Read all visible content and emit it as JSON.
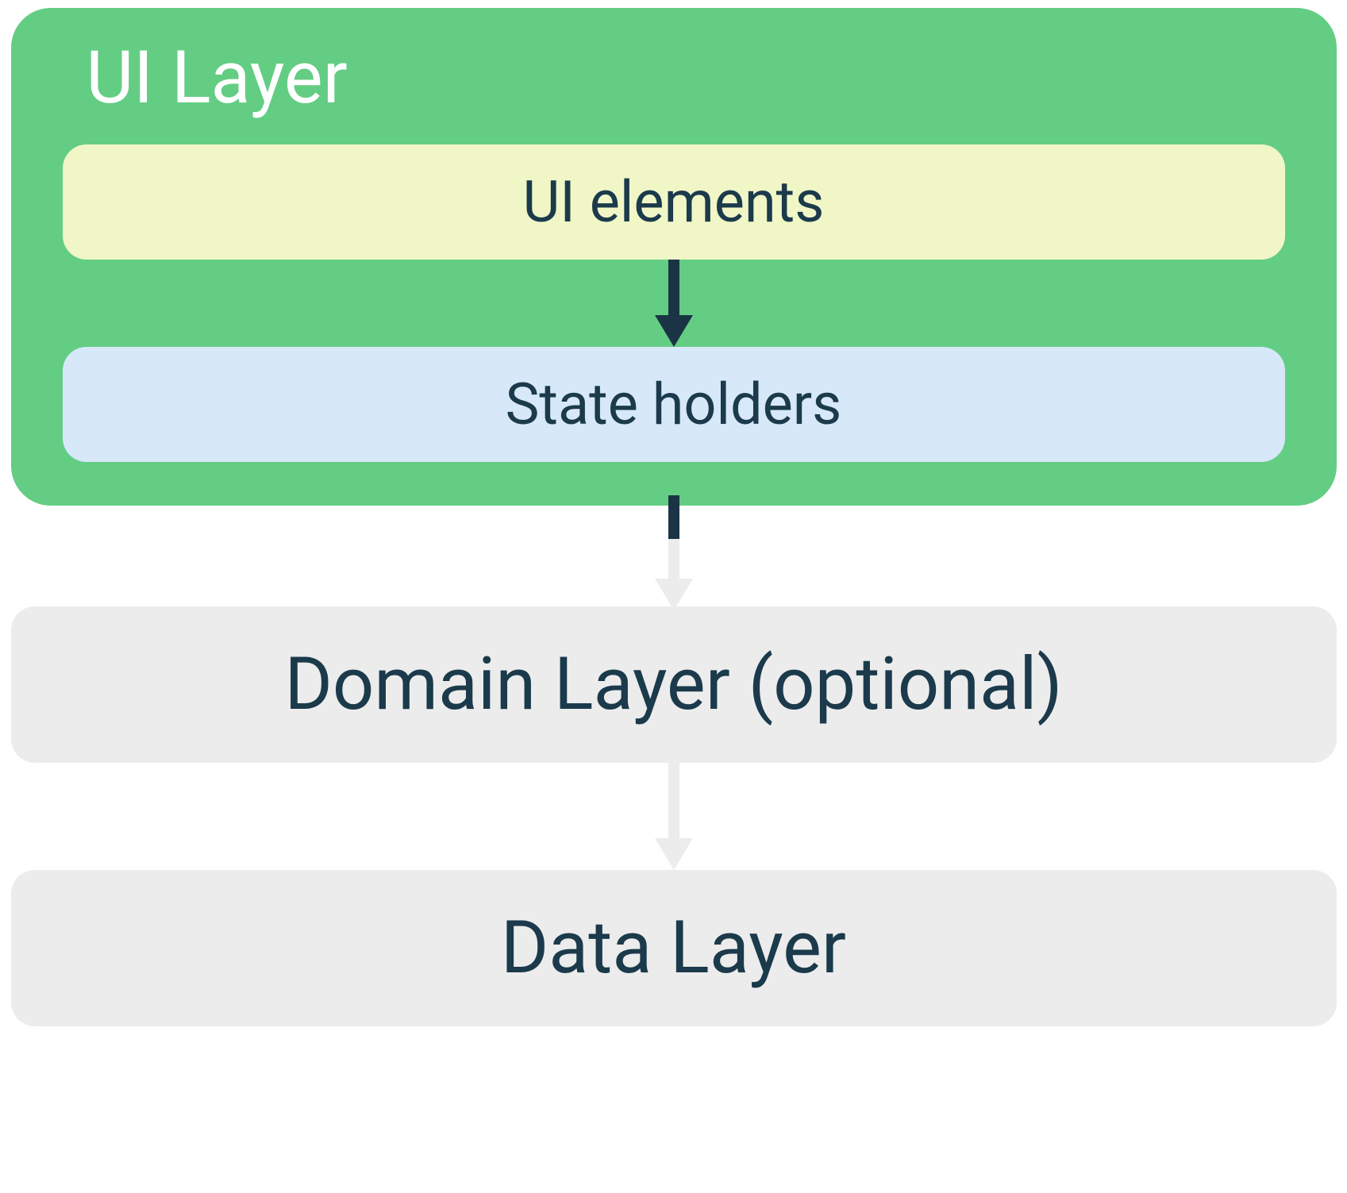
{
  "ui_layer": {
    "title": "UI Layer",
    "ui_elements": "UI elements",
    "state_holders": "State holders"
  },
  "domain_layer": {
    "label": "Domain Layer (optional)"
  },
  "data_layer": {
    "label": "Data Layer"
  },
  "colors": {
    "ui_layer_bg": "#63cd84",
    "ui_elements_bg": "#f1f6c7",
    "state_holders_bg": "#d7e8f8",
    "layer_box_bg": "#ececec",
    "text_dark": "#1b3a4b",
    "text_white": "#ffffff",
    "arrow_dark": "#1b3445",
    "arrow_light": "#ececec"
  }
}
